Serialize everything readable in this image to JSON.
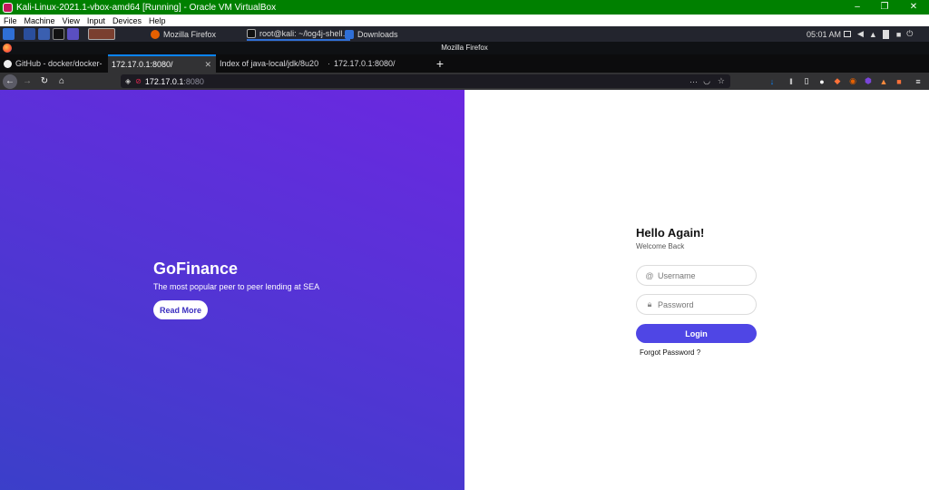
{
  "vbox": {
    "title": "Kali-Linux-2021.1-vbox-amd64 [Running] - Oracle VM VirtualBox",
    "menu": [
      "File",
      "Machine",
      "View",
      "Input",
      "Devices",
      "Help"
    ],
    "controls": [
      "–",
      "❐",
      "✕"
    ]
  },
  "kali_panel": {
    "tasks": [
      "Mozilla Firefox",
      "root@kali: ~/log4j-shell…",
      "Downloads"
    ],
    "clock": "05:01 AM"
  },
  "firefox": {
    "window_title": "Mozilla Firefox",
    "tabs": [
      {
        "label": "GitHub - docker/docker-",
        "active": false
      },
      {
        "label": "172.17.0.1:8080/",
        "active": true
      },
      {
        "label": "Index of java-local/jdk/8u20",
        "active": false
      },
      {
        "label": "172.17.0.1:8080/",
        "active": false
      }
    ],
    "new_tab": "+",
    "url_host": "172.17.0.1",
    "url_port": ":8080"
  },
  "page": {
    "hero_title": "GoFinance",
    "hero_subtitle": "The most popular peer to peer lending at SEA",
    "read_more": "Read More",
    "login_title": "Hello Again!",
    "login_sub": "Welcome Back",
    "username_placeholder": "Username",
    "password_placeholder": "Password",
    "login_button": "Login",
    "forgot": "Forgot Password ?"
  },
  "colors": {
    "vbox_title": "#008000",
    "accent": "#4f46e5",
    "hero_top": "#6b28e0",
    "hero_bottom": "#3b3fc9"
  }
}
